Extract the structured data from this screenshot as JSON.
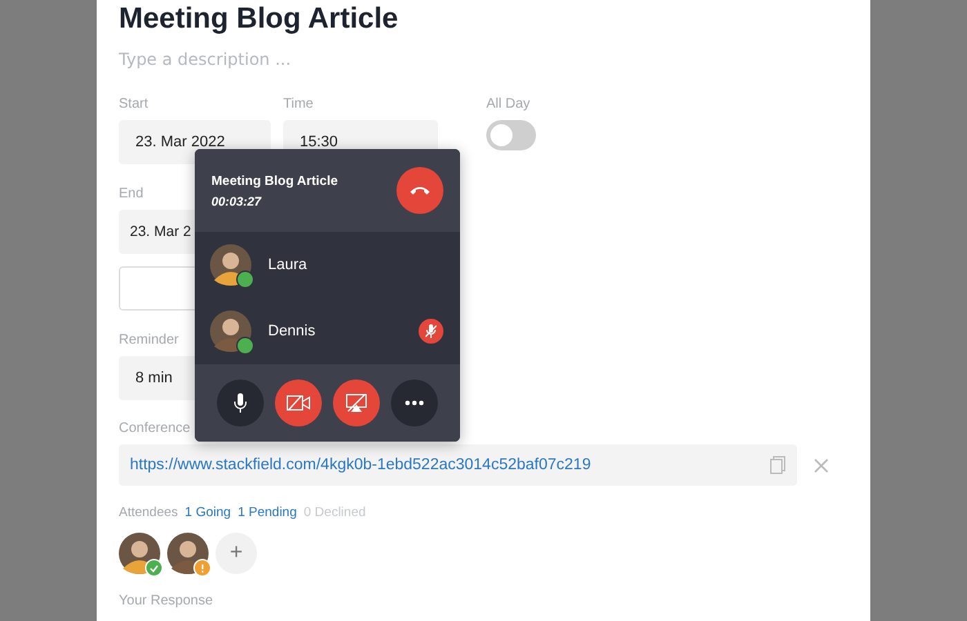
{
  "event": {
    "title": "Meeting Blog Article",
    "description_placeholder": "Type a description ...",
    "start": {
      "label": "Start",
      "value": "23. Mar 2022"
    },
    "time": {
      "label": "Time",
      "value": "15:30"
    },
    "all_day": {
      "label": "All Day",
      "on": false
    },
    "end": {
      "label": "End",
      "value": "23. Mar 2"
    },
    "reminder": {
      "label": "Reminder",
      "value": "8 min"
    },
    "conference": {
      "label": "Conference",
      "url": "https://www.stackfield.com/4kgk0b-1ebd522ac3014c52baf07c219"
    },
    "attendees": {
      "label": "Attendees",
      "going": "1 Going",
      "pending": "1 Pending",
      "declined": "0 Declined",
      "people": [
        {
          "kind": "going",
          "color": "#e8a33a"
        },
        {
          "kind": "pending",
          "color": "#7a5a40"
        }
      ],
      "add": "+"
    },
    "response_label": "Your Response"
  },
  "call": {
    "title": "Meeting Blog Article",
    "duration": "00:03:27",
    "participants": [
      {
        "name": "Laura",
        "muted": false,
        "color": "#e8a33a"
      },
      {
        "name": "Dennis",
        "muted": true,
        "color": "#7a5a40"
      }
    ],
    "controls": [
      {
        "kind": "mic",
        "off": false
      },
      {
        "kind": "camera",
        "off": true
      },
      {
        "kind": "screen",
        "off": true
      },
      {
        "kind": "more",
        "off": false
      }
    ]
  }
}
